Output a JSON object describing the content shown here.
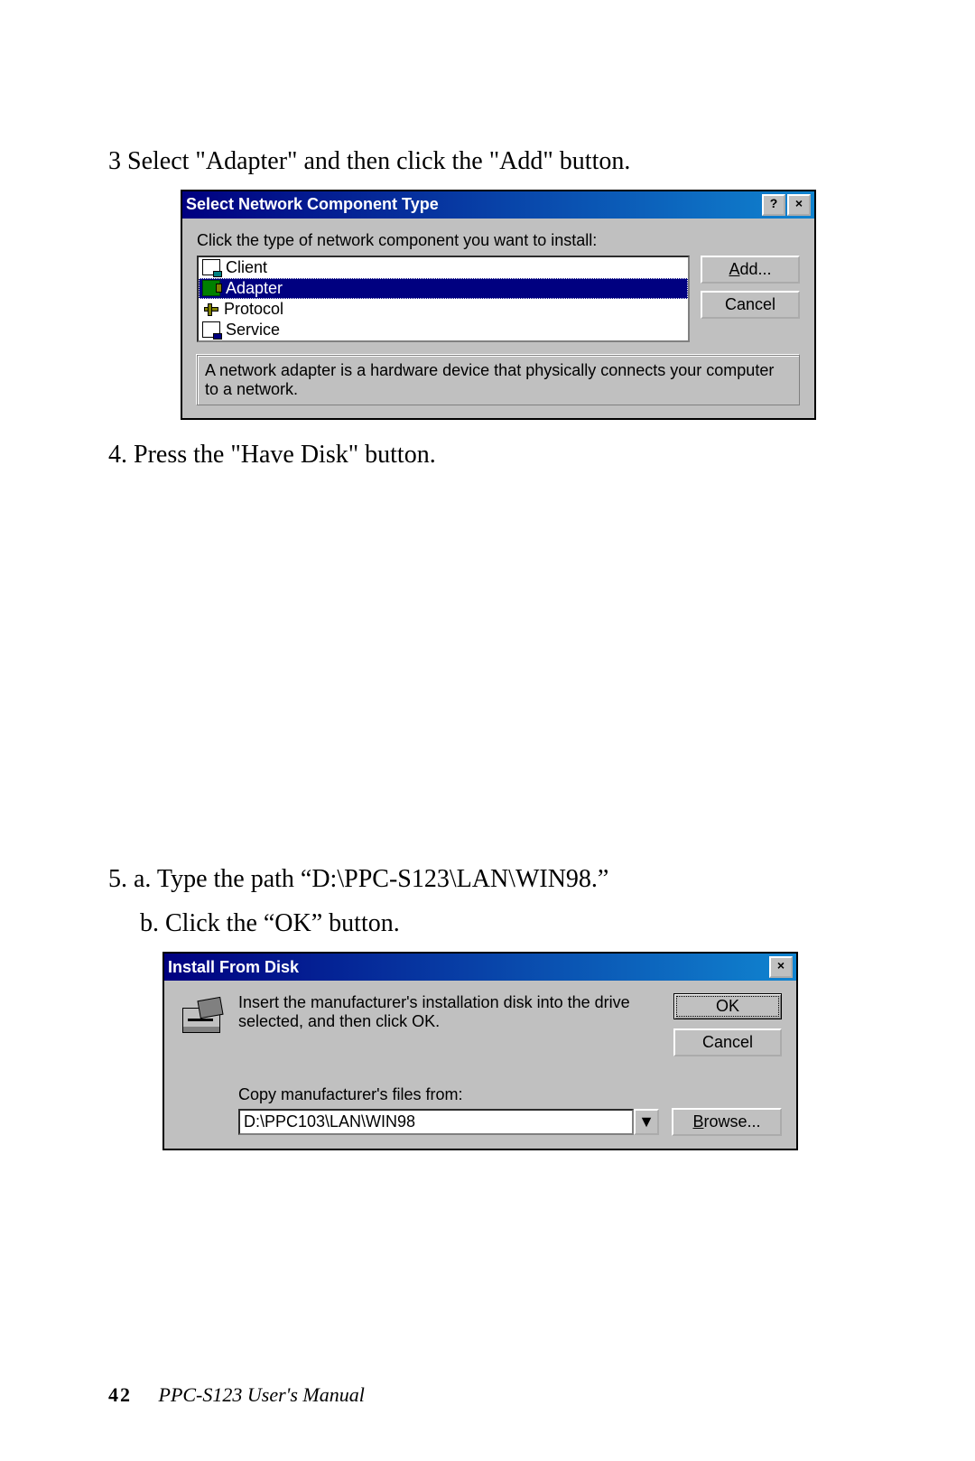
{
  "steps": {
    "s3": "3   Select \"Adapter\" and then click the \"Add\" button.",
    "s4": "4.  Press the \"Have Disk\" button.",
    "s5a": "5.  a. Type the path “D:\\PPC-S123\\LAN\\WIN98.”",
    "s5b": "     b. Click the “OK” button."
  },
  "dialog1": {
    "title": "Select Network Component Type",
    "instruction": "Click the type of network component you want to install:",
    "items": [
      "Client",
      "Adapter",
      "Protocol",
      "Service"
    ],
    "buttons": {
      "add_prefix": "A",
      "add_suffix": "dd...",
      "cancel": "Cancel"
    },
    "description": "A network adapter is a hardware device that physically connects your computer to a network."
  },
  "dialog2": {
    "title": "Install From Disk",
    "instruction": "Insert the manufacturer's installation disk into the drive selected, and then click OK.",
    "ok": "OK",
    "cancel": "Cancel",
    "copy_label": "Copy manufacturer's files from:",
    "path_value": "D:\\PPC103\\LAN\\WIN98",
    "browse_prefix": "B",
    "browse_suffix": "rowse..."
  },
  "footer": {
    "page": "42",
    "book": "PPC-S123  User's Manual"
  }
}
